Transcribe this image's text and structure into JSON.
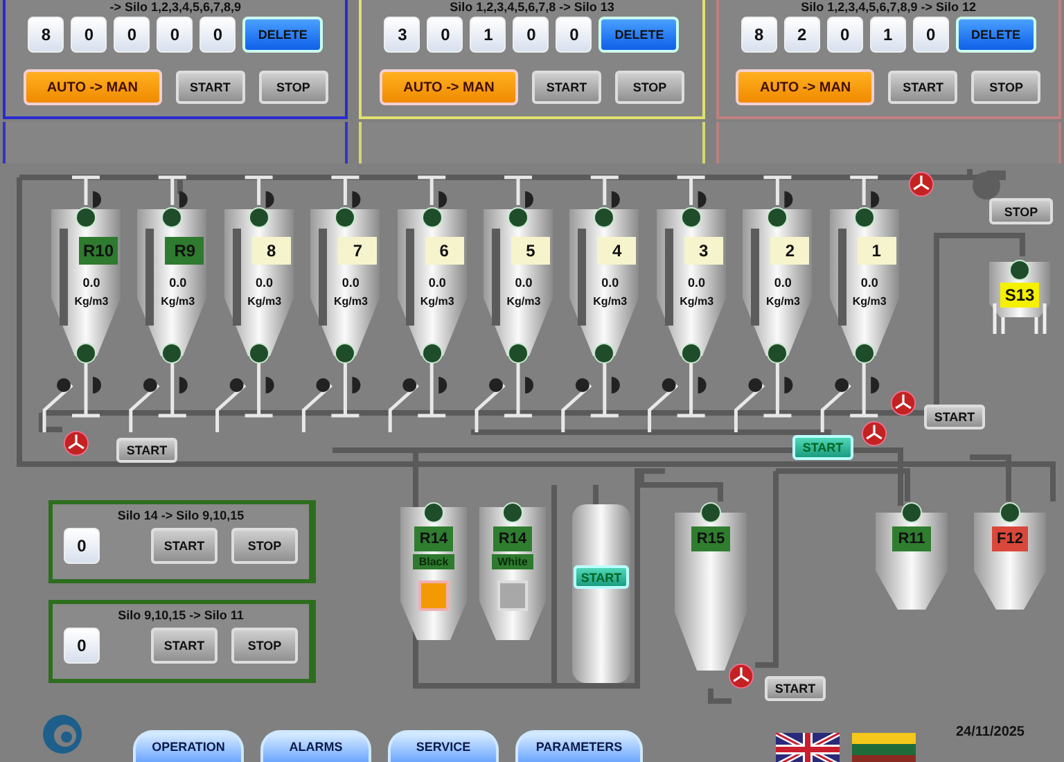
{
  "transfer_panels": [
    {
      "title": "-> Silo 1,2,3,4,5,6,7,8,9",
      "color": "#2b2bd0",
      "digits": [
        "8",
        "0",
        "0",
        "0",
        "0"
      ],
      "delete": "DELETE",
      "mode": "AUTO -> MAN",
      "start": "START",
      "stop": "STOP"
    },
    {
      "title": "Silo 1,2,3,4,5,6,7,8 -> Silo 13",
      "color": "#e0e070",
      "digits": [
        "3",
        "0",
        "1",
        "0",
        "0"
      ],
      "delete": "DELETE",
      "mode": "AUTO -> MAN",
      "start": "START",
      "stop": "STOP"
    },
    {
      "title": "Silo 1,2,3,4,5,6,7,8,9 -> Silo 12",
      "color": "#c08080",
      "digits": [
        "8",
        "2",
        "0",
        "1",
        "0"
      ],
      "delete": "DELETE",
      "mode": "AUTO -> MAN",
      "start": "START",
      "stop": "STOP"
    }
  ],
  "silos": [
    {
      "label": "R10",
      "kind": "tagged",
      "value": "0.0",
      "unit": "Kg/m3"
    },
    {
      "label": "R9",
      "kind": "tagged",
      "value": "0.0",
      "unit": "Kg/m3"
    },
    {
      "label": "8",
      "kind": "numbered",
      "value": "0.0",
      "unit": "Kg/m3"
    },
    {
      "label": "7",
      "kind": "numbered",
      "value": "0.0",
      "unit": "Kg/m3"
    },
    {
      "label": "6",
      "kind": "numbered",
      "value": "0.0",
      "unit": "Kg/m3"
    },
    {
      "label": "5",
      "kind": "numbered",
      "value": "0.0",
      "unit": "Kg/m3"
    },
    {
      "label": "4",
      "kind": "numbered",
      "value": "0.0",
      "unit": "Kg/m3"
    },
    {
      "label": "3",
      "kind": "numbered",
      "value": "0.0",
      "unit": "Kg/m3"
    },
    {
      "label": "2",
      "kind": "numbered",
      "value": "0.0",
      "unit": "Kg/m3"
    },
    {
      "label": "1",
      "kind": "numbered",
      "value": "0.0",
      "unit": "Kg/m3"
    }
  ],
  "blower": {
    "stop": "STOP"
  },
  "s13": {
    "label": "S13"
  },
  "line_buttons": [
    {
      "label": "START",
      "active": false
    },
    {
      "label": "START",
      "active": true
    },
    {
      "label": "START",
      "active": false
    },
    {
      "label": "START",
      "active": false
    }
  ],
  "small_panels": [
    {
      "title": "Silo 14 -> Silo 9,10,15",
      "value": "0",
      "start": "START",
      "stop": "STOP"
    },
    {
      "title": "Silo 9,10,15 -> Silo 11",
      "value": "0",
      "start": "START",
      "stop": "STOP"
    }
  ],
  "lower_silos": [
    {
      "label": "R14",
      "color": "#2f7d2f",
      "tag": "Black",
      "kind": "color_bin",
      "indicator_on": true
    },
    {
      "label": "R14",
      "color": "#2f7d2f",
      "tag": "White",
      "kind": "color_bin",
      "indicator_on": false
    },
    {
      "kind": "mixer",
      "start": "START"
    },
    {
      "label": "R15",
      "color": "#2f7d2f",
      "kind": "silo"
    },
    {
      "label": "R11",
      "color": "#2f7d2f",
      "kind": "silo"
    },
    {
      "label": "F12",
      "color": "#d9483b",
      "kind": "silo"
    }
  ],
  "nav": [
    {
      "label": "OPERATION"
    },
    {
      "label": "ALARMS"
    },
    {
      "label": "SERVICE"
    },
    {
      "label": "PARAMETERS"
    }
  ],
  "date": "24/11/2025"
}
